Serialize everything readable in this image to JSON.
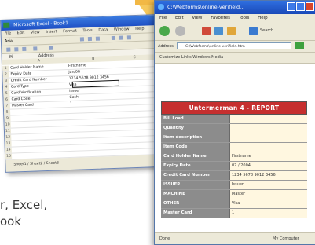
{
  "caption": {
    "line1": "r, Excel,",
    "line2": "ook"
  },
  "excel": {
    "title": "Microsoft Excel - Book1",
    "menu": [
      "File",
      "Edit",
      "View",
      "Insert",
      "Format",
      "Tools",
      "Data",
      "Window",
      "Help"
    ],
    "font_name": "Arial",
    "cell_ref": "B6",
    "formula_value": "Address",
    "col_headers": [
      "A",
      "B",
      "C"
    ],
    "rows": [
      {
        "n": "1",
        "a": "Card Holder Name",
        "b": "Firstname"
      },
      {
        "n": "2",
        "a": "Expiry Date",
        "b": "Jan/08"
      },
      {
        "n": "3",
        "a": "Credit Card Number",
        "b": "1234 5678 9012 3456"
      },
      {
        "n": "4",
        "a": "Card Type",
        "b": "Visa"
      },
      {
        "n": "5",
        "a": "Card Verification",
        "b": "Issuer"
      },
      {
        "n": "6",
        "a": "Card Code",
        "b": "Cash"
      },
      {
        "n": "7",
        "a": "Master Card",
        "b": "1"
      },
      {
        "n": "8",
        "a": "",
        "b": ""
      },
      {
        "n": "9",
        "a": "",
        "b": ""
      },
      {
        "n": "10",
        "a": "",
        "b": ""
      },
      {
        "n": "11",
        "a": "",
        "b": ""
      },
      {
        "n": "12",
        "a": "",
        "b": ""
      },
      {
        "n": "13",
        "a": "",
        "b": ""
      },
      {
        "n": "14",
        "a": "",
        "b": ""
      },
      {
        "n": "15",
        "a": "",
        "b": ""
      }
    ],
    "sheet_tab": "Sheet1 / Sheet2 / Sheet3"
  },
  "ie": {
    "title": "C:\\Webforms\\online-verifield...",
    "menu": [
      "File",
      "Edit",
      "View",
      "Favorites",
      "Tools",
      "Help"
    ],
    "search_label": "Search",
    "address_label": "Address",
    "address_value": "C:\\Webforms\\online-verifield.htm",
    "links_text": "Customize Links    Windows Media",
    "form_title": "Untermerman 4 - REPORT",
    "form_rows": [
      {
        "label": "Bill Load",
        "value": ""
      },
      {
        "label": "Quantity",
        "value": ""
      },
      {
        "label": "Item description",
        "value": ""
      },
      {
        "label": "Item Code",
        "value": ""
      },
      {
        "label": "Card Holder Name",
        "value": "Firstname"
      },
      {
        "label": "Expiry Date",
        "value": "07 / 2004"
      },
      {
        "label": "Credit Card Number",
        "value": "1234 5678 9012 3456"
      },
      {
        "label": "ISSUER",
        "value": "Issuer"
      },
      {
        "label": "MACHINE",
        "value": "Master"
      },
      {
        "label": "OTHER",
        "value": "Visa"
      },
      {
        "label": "Master Card",
        "value": "1"
      }
    ],
    "status_left": "Done",
    "status_right": "My Computer"
  },
  "colors": {
    "arrow": "#f6c85c",
    "form_header": "#c62f2f",
    "title_bar": "#2f6fe0"
  }
}
